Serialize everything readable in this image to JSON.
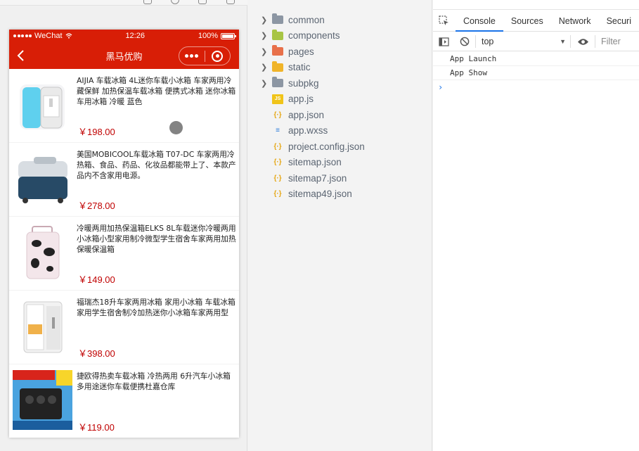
{
  "simulator": {
    "status_bar": {
      "carrier": "WeChat",
      "time": "12:26",
      "battery": "100%",
      "battery_level": 1.0
    },
    "nav": {
      "title": "黑马优购"
    },
    "goods": [
      {
        "name": "AIJIA 车载冰箱 4L迷你车载小冰箱 车家两用冷藏保鲜 加热保温车载冰箱 便携式冰箱 迷你冰箱 车用冰箱 冷暖 蓝色",
        "price": "￥198.00",
        "image": "mini-fridge-blue"
      },
      {
        "name": "美国MOBICOOL车载冰箱 T07-DC 车家两用冷热箱、食品、药品、化妆品都能带上了、本款产品内不含家用电源。",
        "price": "￥278.00",
        "image": "cooler-box"
      },
      {
        "name": "冷暖两用加热保温箱ELKS 8L车载迷你冷暖两用小冰箱小型家用制冷微型学生宿舍车家两用加热保暖保温箱",
        "price": "￥149.00",
        "image": "cow-print-fridge"
      },
      {
        "name": "福瑞杰18升车家两用冰箱 家用小冰箱 车载冰箱家用学生宿舍制冷加热迷你小冰箱车家两用型",
        "price": "￥398.00",
        "image": "white-fridge"
      },
      {
        "name": "捷欧得热卖车载冰箱 冷热两用 6升汽车小冰箱 多用途迷你车载便携杜嘉仓库",
        "price": "￥119.00",
        "image": "car-fridge-ad"
      }
    ]
  },
  "explorer": {
    "items": [
      {
        "label": "common",
        "kind": "folder",
        "color": "#8c96a3",
        "expandable": true
      },
      {
        "label": "components",
        "kind": "folder",
        "color": "#a8c545",
        "expandable": true
      },
      {
        "label": "pages",
        "kind": "folder",
        "color": "#e8704a",
        "expandable": true
      },
      {
        "label": "static",
        "kind": "folder",
        "color": "#f0b429",
        "expandable": true
      },
      {
        "label": "subpkg",
        "kind": "folder",
        "color": "#8c96a3",
        "expandable": true
      },
      {
        "label": "app.js",
        "kind": "js",
        "expandable": false
      },
      {
        "label": "app.json",
        "kind": "json",
        "expandable": false
      },
      {
        "label": "app.wxss",
        "kind": "wxss",
        "expandable": false
      },
      {
        "label": "project.config.json",
        "kind": "json",
        "expandable": false
      },
      {
        "label": "sitemap.json",
        "kind": "json",
        "expandable": false
      },
      {
        "label": "sitemap7.json",
        "kind": "json",
        "expandable": false
      },
      {
        "label": "sitemap49.json",
        "kind": "json",
        "expandable": false
      }
    ]
  },
  "devtools": {
    "tabs": [
      "Console",
      "Sources",
      "Network",
      "Securi"
    ],
    "active_tab": "Console",
    "context": "top",
    "filter_placeholder": "Filter",
    "logs": [
      "App Launch",
      "App Show"
    ],
    "prompt_symbol": "›"
  },
  "colors": {
    "brand_red": "#d81e06",
    "price_red": "#c00000",
    "tab_accent": "#1a73e8"
  }
}
